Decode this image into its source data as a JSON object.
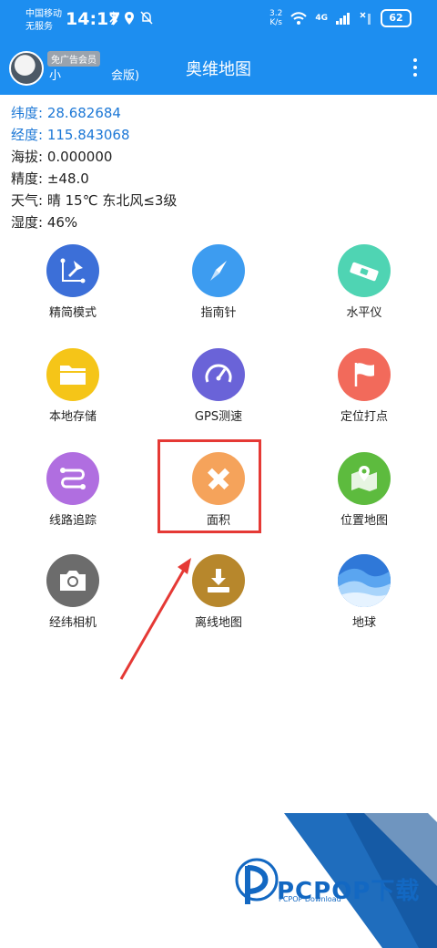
{
  "status_bar": {
    "carrier_line1": "中国移动",
    "carrier_line2": "无服务",
    "time": "14:17",
    "net_speed_value": "3.2",
    "net_speed_unit": "K/s",
    "network_type": "4G",
    "battery": "62"
  },
  "app_bar": {
    "badge": "免广告会员",
    "user_name": "小",
    "membership": "会版)",
    "title": "奥维地图"
  },
  "info": {
    "latitude_label": "纬度:",
    "latitude_value": "28.682684",
    "longitude_label": "经度:",
    "longitude_value": "115.843068",
    "altitude_label": "海拔:",
    "altitude_value": "0.000000",
    "accuracy_label": "精度:",
    "accuracy_value": "±48.0",
    "weather_label": "天气:",
    "weather_value": "晴  15℃  东北风≤3级",
    "humidity_label": "湿度:",
    "humidity_value": "46%"
  },
  "tiles": [
    {
      "label": "精简模式",
      "color": "#3c6fd8"
    },
    {
      "label": "指南针",
      "color": "#3d9cf0"
    },
    {
      "label": "水平仪",
      "color": "#4fd4b3"
    },
    {
      "label": "本地存储",
      "color": "#f5c518"
    },
    {
      "label": "GPS测速",
      "color": "#6a63d8"
    },
    {
      "label": "定位打点",
      "color": "#f26a5b"
    },
    {
      "label": "线路追踪",
      "color": "#b06ee0"
    },
    {
      "label": "面积",
      "color": "#f5a35b"
    },
    {
      "label": "位置地图",
      "color": "#5dbb3e"
    },
    {
      "label": "经纬相机",
      "color": "#6c6c6c"
    },
    {
      "label": "离线地图",
      "color": "#b7872c"
    },
    {
      "label": "地球",
      "color": "#2f78d8"
    }
  ],
  "watermark": {
    "brand": "PCPOP下载",
    "sub": "PCPOP Download"
  },
  "colors": {
    "primary": "#1d8ef0",
    "highlight": "#e53935",
    "watermark": "#1368c2"
  }
}
